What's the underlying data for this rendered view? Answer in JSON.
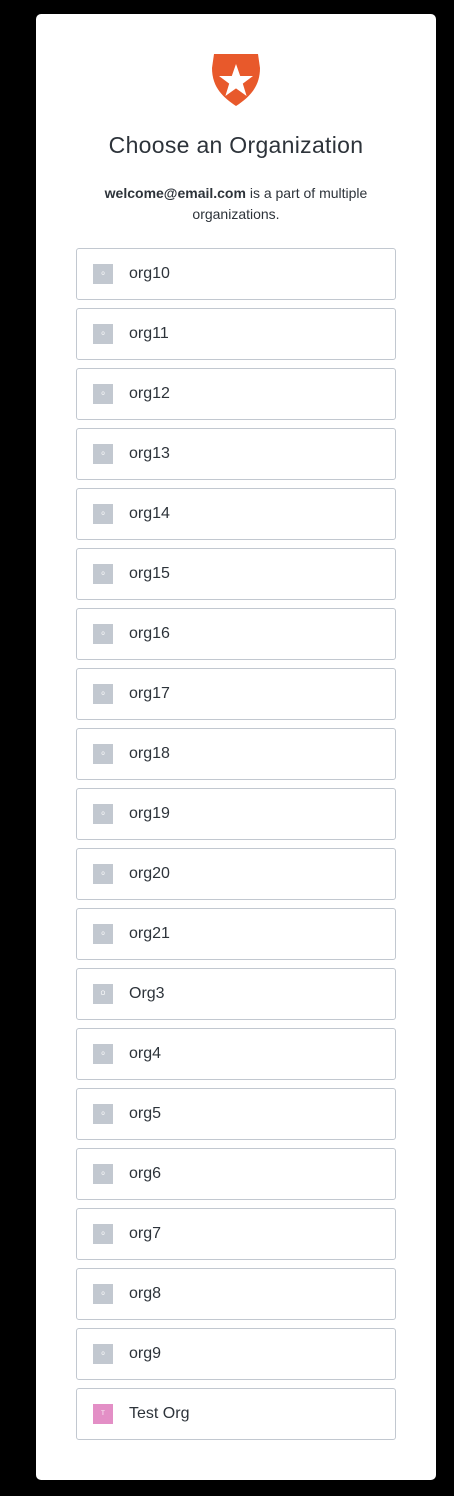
{
  "logo": {
    "icon": "auth0-shield-star-icon",
    "color": "#e8592b"
  },
  "title": "Choose an Organization",
  "subtitle": {
    "email": "welcome@email.com",
    "text": " is a part of multiple organizations."
  },
  "colors": {
    "default_avatar": "#c2c8d0",
    "test_org_avatar": "#e38fc6"
  },
  "organizations": [
    {
      "name": "org10",
      "initial": "o"
    },
    {
      "name": "org11",
      "initial": "o"
    },
    {
      "name": "org12",
      "initial": "o"
    },
    {
      "name": "org13",
      "initial": "o"
    },
    {
      "name": "org14",
      "initial": "o"
    },
    {
      "name": "org15",
      "initial": "o"
    },
    {
      "name": "org16",
      "initial": "o"
    },
    {
      "name": "org17",
      "initial": "o"
    },
    {
      "name": "org18",
      "initial": "o"
    },
    {
      "name": "org19",
      "initial": "o"
    },
    {
      "name": "org20",
      "initial": "o"
    },
    {
      "name": "org21",
      "initial": "o"
    },
    {
      "name": "Org3",
      "initial": "O"
    },
    {
      "name": "org4",
      "initial": "o"
    },
    {
      "name": "org5",
      "initial": "o"
    },
    {
      "name": "org6",
      "initial": "o"
    },
    {
      "name": "org7",
      "initial": "o"
    },
    {
      "name": "org8",
      "initial": "o"
    },
    {
      "name": "org9",
      "initial": "o"
    },
    {
      "name": "Test Org",
      "initial": "T",
      "color": "#e38fc6"
    }
  ]
}
